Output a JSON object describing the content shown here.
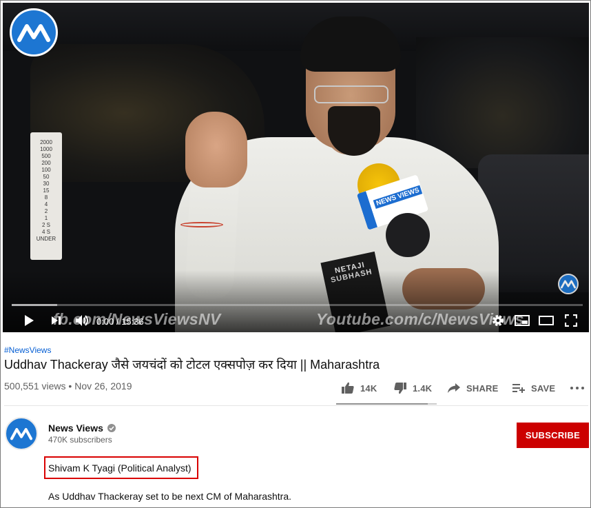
{
  "player": {
    "current_time": "0:00",
    "duration": "15:36",
    "time_separator": "/",
    "progress_fraction": 0.0,
    "buffered_fraction": 0.08,
    "overlay_left": "fb.com/NewsViewsNV",
    "overlay_right": "Youtube.com/c/NewsViews",
    "mic_flag_text": "NEWS VIEWS",
    "book_text": "NETAJI SUBHASH",
    "rate_card_lines": [
      "2000",
      "1000",
      "500",
      "200",
      "100",
      "50",
      "30",
      "15",
      "8",
      "4",
      "2",
      "1",
      "2 S",
      "4 S",
      "UNDER"
    ],
    "icons": [
      "play-icon",
      "next-icon",
      "volume-icon",
      "settings-icon",
      "miniplayer-icon",
      "theater-icon",
      "fullscreen-icon"
    ]
  },
  "video": {
    "hashtag": "#NewsViews",
    "title": "Uddhav Thackeray जैसे जयचंदों को टोटल एक्सपोज़ कर दिया || Maharashtra",
    "views": "500,551 views",
    "date_separator": "•",
    "date": "Nov 26, 2019"
  },
  "actions": {
    "likes": "14K",
    "dislikes": "1.4K",
    "share": "SHARE",
    "save": "SAVE",
    "like_ratio": 0.91
  },
  "channel": {
    "name": "News Views",
    "subscribers": "470K subscribers",
    "subscribe_label": "SUBSCRIBE"
  },
  "description": {
    "highlighted": "Shivam K Tyagi (Political Analyst)",
    "line1": "As Uddhav Thackeray set to be next CM of Maharashtra."
  },
  "colors": {
    "subscribe": "#cc0000",
    "highlight_border": "#d90000",
    "link": "#065fd4",
    "brand_blue": "#1d76d2"
  }
}
